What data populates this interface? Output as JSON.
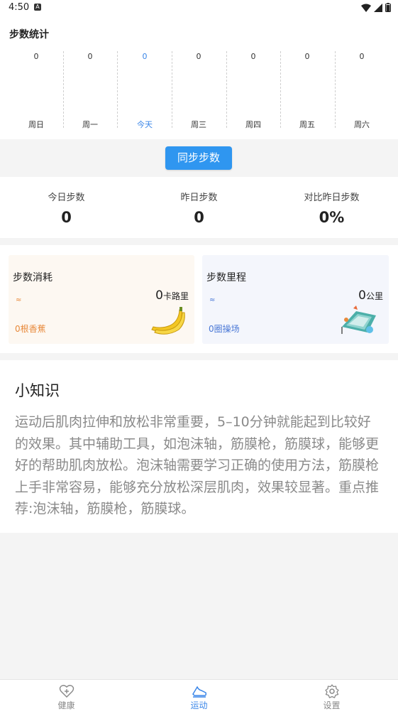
{
  "status": {
    "time": "4:50",
    "badge": "A"
  },
  "chart": {
    "title": "步数统计",
    "days": [
      {
        "label": "周日",
        "value": "0"
      },
      {
        "label": "周一",
        "value": "0"
      },
      {
        "label": "今天",
        "value": "0",
        "today": true
      },
      {
        "label": "周三",
        "value": "0"
      },
      {
        "label": "周四",
        "value": "0"
      },
      {
        "label": "周五",
        "value": "0"
      },
      {
        "label": "周六",
        "value": "0"
      }
    ],
    "colors": {
      "today": "#3a86e8",
      "normal": "#333333"
    }
  },
  "sync_button": "同步步数",
  "stats": [
    {
      "label": "今日步数",
      "value": "0"
    },
    {
      "label": "昨日步数",
      "value": "0"
    },
    {
      "label": "对比昨日步数",
      "value": "0%"
    }
  ],
  "calorie_card": {
    "title": "步数消耗",
    "value": "0",
    "unit": "卡路里",
    "approx": "≈",
    "equivalent": "0根香蕉",
    "icon": "banana-icon"
  },
  "distance_card": {
    "title": "步数里程",
    "value": "0",
    "unit": "公里",
    "approx": "≈",
    "equivalent": "0圈操场",
    "icon": "running-track-icon"
  },
  "tips": {
    "title": "小知识",
    "body": "运动后肌肉拉伸和放松非常重要，5–10分钟就能起到比较好的效果。其中辅助工具，如泡沫轴，筋膜枪，筋膜球，能够更好的帮助肌肉放松。泡沫轴需要学习正确的使用方法，筋膜枪上手非常容易，能够充分放松深层肌肉，效果较显著。重点推荐:泡沫轴，筋膜枪，筋膜球。"
  },
  "nav": [
    {
      "label": "健康",
      "icon": "heart-plus-icon",
      "active": false
    },
    {
      "label": "运动",
      "icon": "sneaker-icon",
      "active": true
    },
    {
      "label": "设置",
      "icon": "gear-icon",
      "active": false
    }
  ],
  "accent": "#2f96f0"
}
